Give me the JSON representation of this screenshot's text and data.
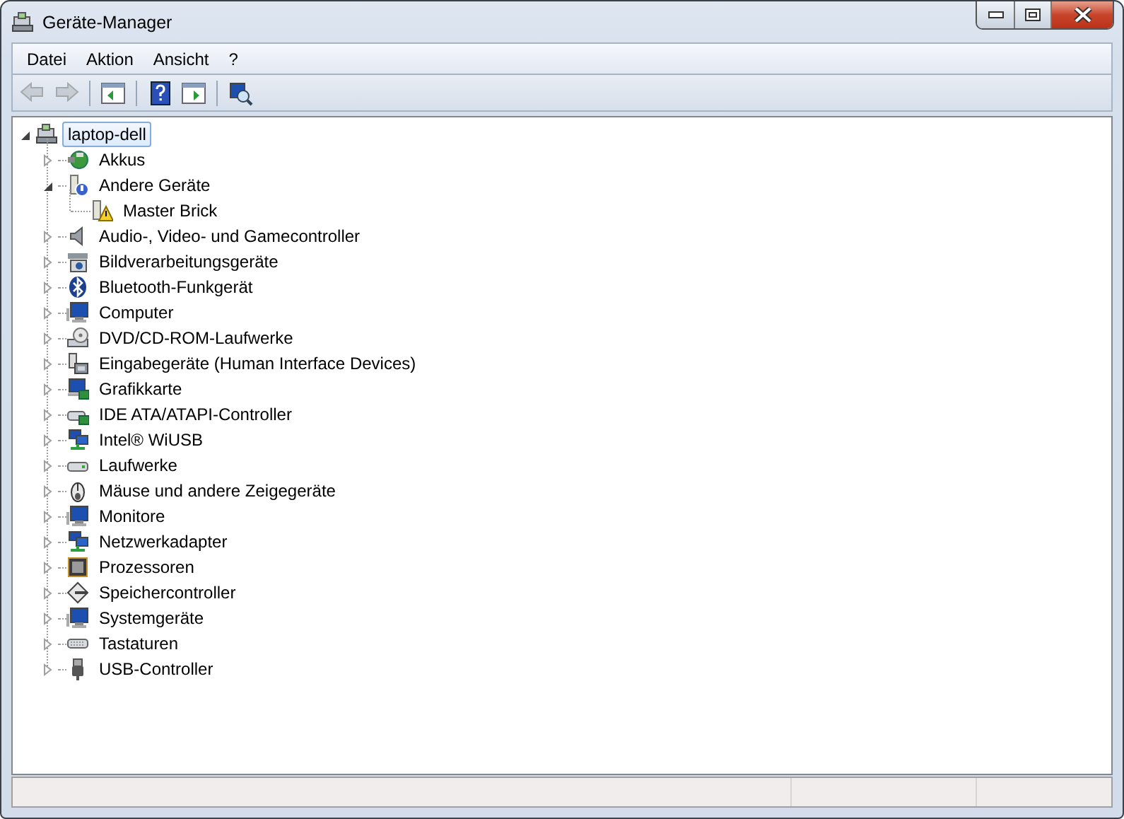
{
  "window": {
    "title": "Geräte-Manager"
  },
  "menu": [
    {
      "label": "Datei"
    },
    {
      "label": "Aktion"
    },
    {
      "label": "Ansicht"
    },
    {
      "label": "?"
    }
  ],
  "toolbar": [
    {
      "kind": "back",
      "disabled": true
    },
    {
      "kind": "forward",
      "disabled": true
    },
    {
      "kind": "separator"
    },
    {
      "kind": "console-tree",
      "disabled": false
    },
    {
      "kind": "separator"
    },
    {
      "kind": "help",
      "disabled": false
    },
    {
      "kind": "action-pane",
      "disabled": false
    },
    {
      "kind": "separator"
    },
    {
      "kind": "scan",
      "disabled": false
    }
  ],
  "tree": [
    {
      "label": "laptop-dell",
      "selected": true,
      "expanded": true,
      "children": [
        {
          "label": "Akkus",
          "selected": false,
          "expanded": false
        },
        {
          "label": "Andere Geräte",
          "selected": false,
          "expanded": true,
          "children": [
            {
              "label": "Master Brick",
              "selected": false
            }
          ]
        },
        {
          "label": "Audio-, Video- und Gamecontroller",
          "selected": false,
          "expanded": false
        },
        {
          "label": "Bildverarbeitungsgeräte",
          "selected": false,
          "expanded": false
        },
        {
          "label": "Bluetooth-Funkgerät",
          "selected": false,
          "expanded": false
        },
        {
          "label": "Computer",
          "selected": false,
          "expanded": false
        },
        {
          "label": "DVD/CD-ROM-Laufwerke",
          "selected": false,
          "expanded": false
        },
        {
          "label": "Eingabegeräte (Human Interface Devices)",
          "selected": false,
          "expanded": false
        },
        {
          "label": "Grafikkarte",
          "selected": false,
          "expanded": false
        },
        {
          "label": "IDE ATA/ATAPI-Controller",
          "selected": false,
          "expanded": false
        },
        {
          "label": "Intel® WiUSB",
          "selected": false,
          "expanded": false
        },
        {
          "label": "Laufwerke",
          "selected": false,
          "expanded": false
        },
        {
          "label": "Mäuse und andere Zeigegeräte",
          "selected": false,
          "expanded": false
        },
        {
          "label": "Monitore",
          "selected": false,
          "expanded": false
        },
        {
          "label": "Netzwerkadapter",
          "selected": false,
          "expanded": false
        },
        {
          "label": "Prozessoren",
          "selected": false,
          "expanded": false
        },
        {
          "label": "Speichercontroller",
          "selected": false,
          "expanded": false
        },
        {
          "label": "Systemgeräte",
          "selected": false,
          "expanded": false
        },
        {
          "label": "Tastaturen",
          "selected": false,
          "expanded": false
        },
        {
          "label": "USB-Controller",
          "selected": false,
          "expanded": false
        }
      ]
    }
  ]
}
